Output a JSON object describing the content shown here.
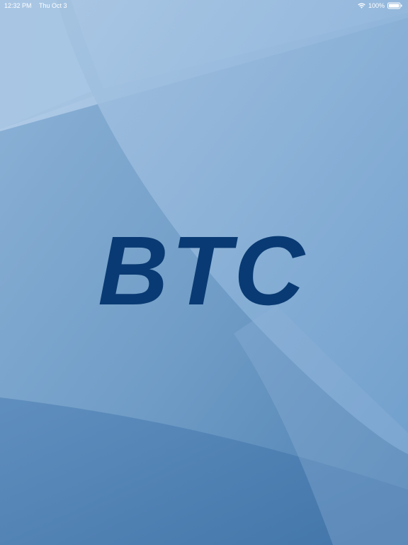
{
  "status_bar": {
    "time": "12:32 PM",
    "date": "Thu Oct 3",
    "battery": "100%",
    "wifi_icon": "wifi-icon",
    "battery_icon": "battery-icon"
  },
  "splash": {
    "logo_text": "BTC"
  },
  "colors": {
    "logo": "#093a73",
    "background_light": "#a7c4e2",
    "background_mid": "#6f9cc6",
    "background_dark": "#3f72a7",
    "status_text": "#ffffff"
  }
}
